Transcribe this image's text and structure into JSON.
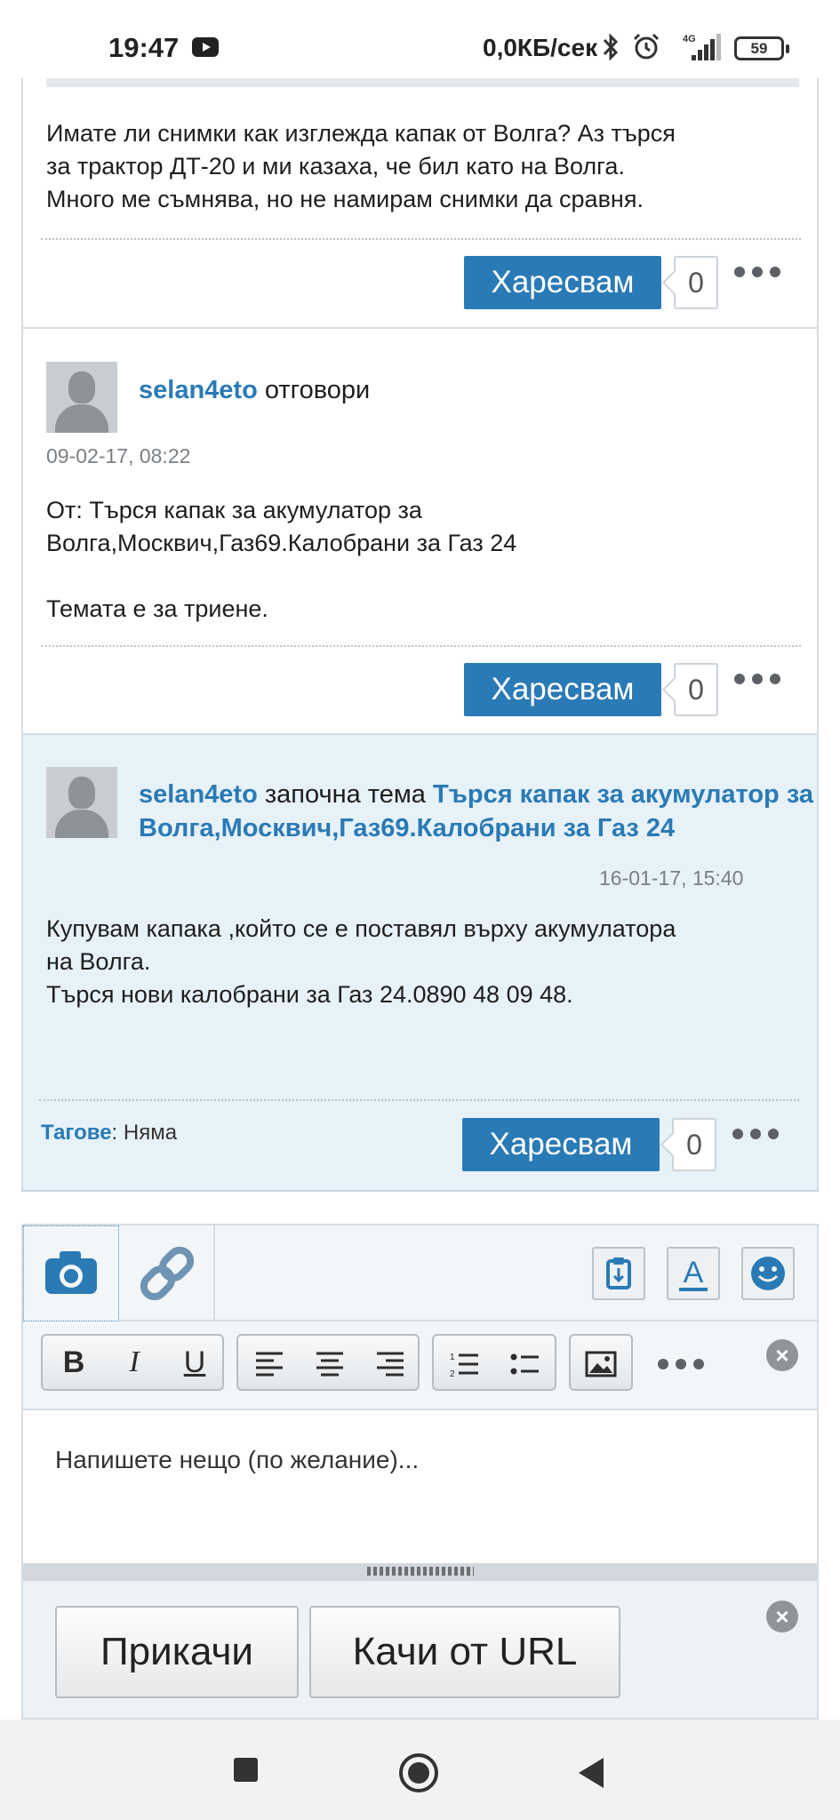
{
  "status_bar": {
    "time": "19:47",
    "speed": "0,0КБ/сек",
    "network": "4G",
    "battery": "59"
  },
  "posts": [
    {
      "text": "Имате ли снимки как изглежда капак от Волга? Аз търся\nза трактор ДТ-20 и ми казаха, че бил като на Волга.\nМного ме съмнява, но не намирам снимки да сравня.",
      "like_label": "Харесвам",
      "like_count": "0"
    },
    {
      "author": "selan4eto",
      "action": " отговори",
      "timestamp": "09-02-17, 08:22",
      "text": "От: Търся капак за акумулатор за\nВолга,Москвич,Газ69.Калобрани за Газ 24\n\nТемата е за триене.",
      "like_label": "Харесвам",
      "like_count": "0"
    },
    {
      "author": "selan4eto",
      "action": " започна тема ",
      "topic": "Търся капак за акумулатор за Волга,Москвич,Газ69.Калобрани за Газ 24",
      "timestamp": "16-01-17, 15:40",
      "text": "Купувам капака ,който се е поставял върху акумулатора\nна Волга.\nТърся нови калобрани за Газ 24.0890 48 09 48.",
      "tags_label": "Тагове",
      "tags_value": ": Няма",
      "like_label": "Харесвам",
      "like_count": "0"
    }
  ],
  "editor": {
    "placeholder": "Напишете нещо (по желание)...",
    "attach_label": "Прикачи",
    "upload_url_label": "Качи от URL"
  },
  "colors": {
    "accent": "#2a7ab5",
    "highlight_bg": "#e7f1f8"
  }
}
